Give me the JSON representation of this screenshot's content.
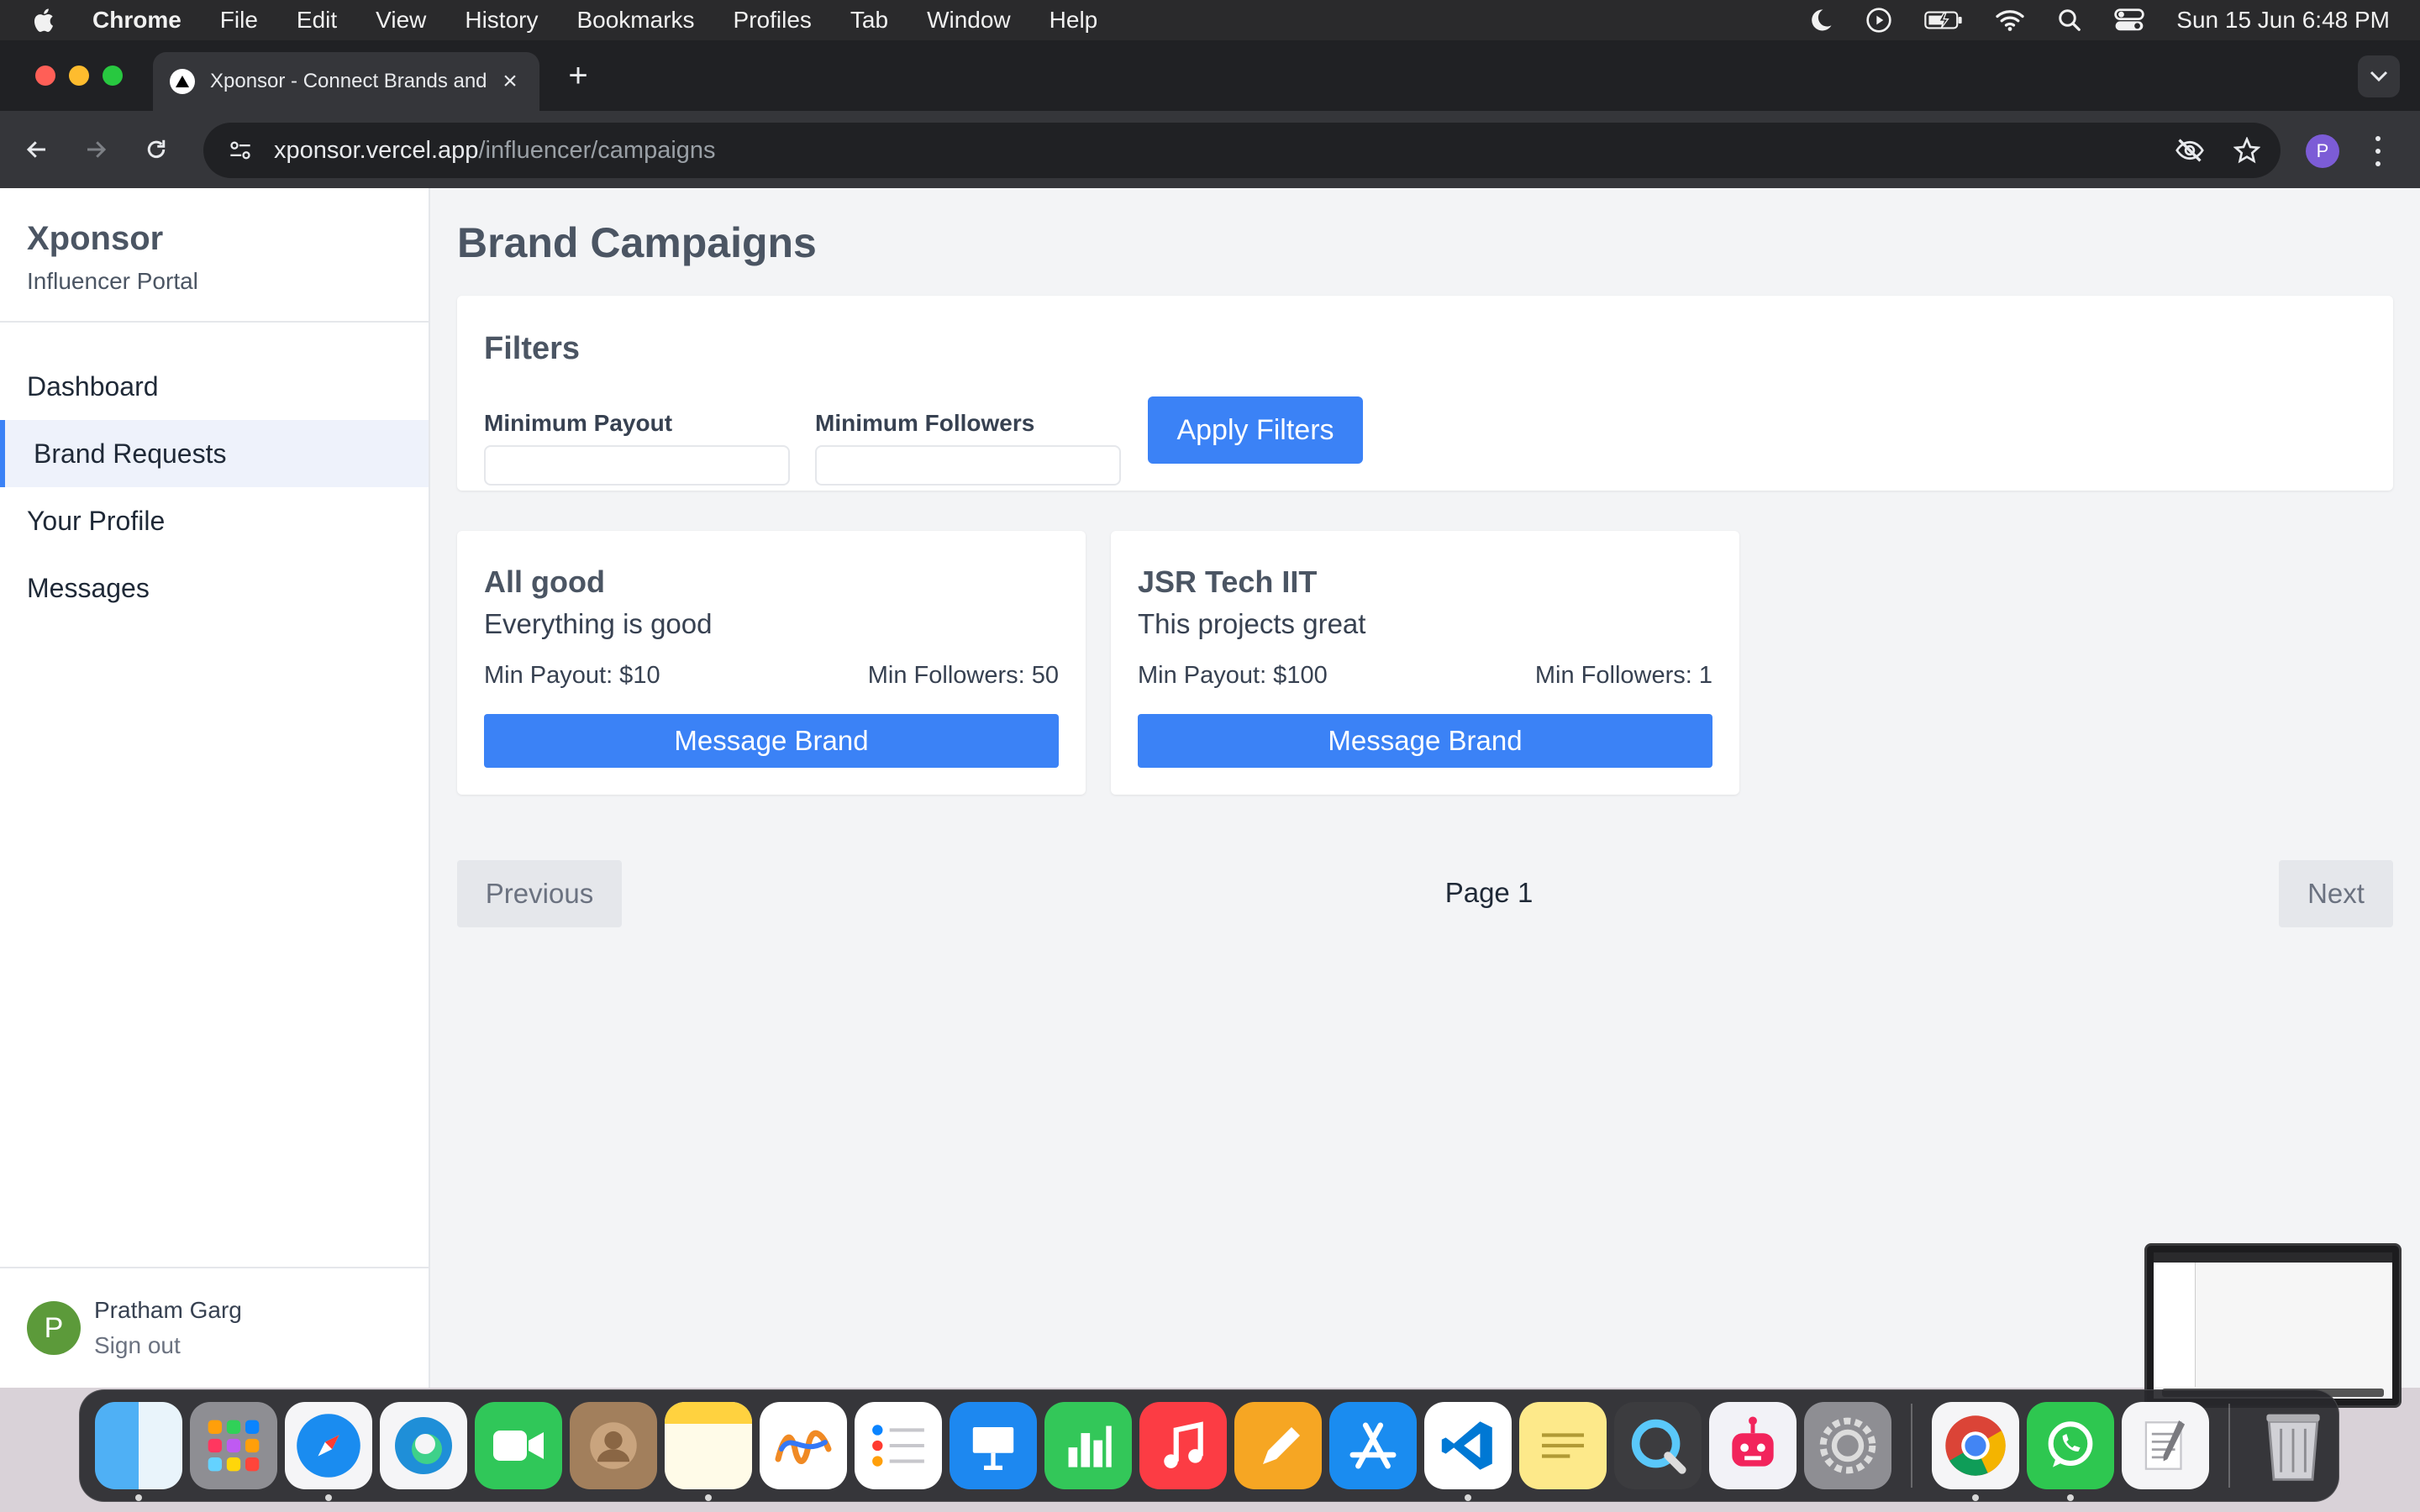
{
  "menubar": {
    "app_name": "Chrome",
    "items": [
      "File",
      "Edit",
      "View",
      "History",
      "Bookmarks",
      "Profiles",
      "Tab",
      "Window",
      "Help"
    ],
    "clock": "Sun 15 Jun  6:48 PM",
    "icons": [
      "moon-icon",
      "play-circle-icon",
      "battery-icon",
      "wifi-icon",
      "search-icon",
      "control-center-icon"
    ]
  },
  "browser": {
    "tab_title": "Xponsor - Connect Brands and",
    "url_host": "xponsor.vercel.app",
    "url_path": "/influencer/campaigns",
    "profile_initial": "P"
  },
  "sidebar": {
    "brand": "Xponsor",
    "subtitle": "Influencer Portal",
    "items": [
      {
        "label": "Dashboard",
        "active": false
      },
      {
        "label": "Brand Requests",
        "active": true
      },
      {
        "label": "Your Profile",
        "active": false
      },
      {
        "label": "Messages",
        "active": false
      }
    ],
    "user": {
      "initial": "P",
      "name": "Pratham Garg",
      "signout": "Sign out"
    }
  },
  "main": {
    "title": "Brand Campaigns",
    "filters": {
      "title": "Filters",
      "min_payout_label": "Minimum Payout",
      "min_payout_value": "",
      "min_followers_label": "Minimum Followers",
      "min_followers_value": "",
      "apply_label": "Apply Filters"
    },
    "campaigns": [
      {
        "title": "All good",
        "description": "Everything is good",
        "payout": "Min Payout: $10",
        "followers": "Min Followers: 50",
        "button": "Message Brand"
      },
      {
        "title": "JSR Tech IIT",
        "description": "This projects great",
        "payout": "Min Payout: $100",
        "followers": "Min Followers: 1",
        "button": "Message Brand"
      }
    ],
    "pagination": {
      "previous": "Previous",
      "page": "Page 1",
      "next": "Next"
    }
  },
  "colors": {
    "accent": "#3b82f6",
    "avatar": "#5c9a3a",
    "profile": "#7c5cd6"
  },
  "dock": {
    "apps": [
      "finder-icon",
      "launchpad-icon",
      "safari-icon",
      "edge-icon",
      "facetime-icon",
      "contacts-icon",
      "notes-icon",
      "freeform-icon",
      "reminders-icon",
      "keynote-icon",
      "numbers-icon",
      "music-icon",
      "pages-icon",
      "app-store-icon",
      "vscode-icon",
      "stickies-icon",
      "quicktime-icon",
      "robot-app-icon",
      "system-settings-icon",
      "chrome-icon",
      "whatsapp-icon",
      "textedit-icon",
      "trash-icon"
    ]
  }
}
